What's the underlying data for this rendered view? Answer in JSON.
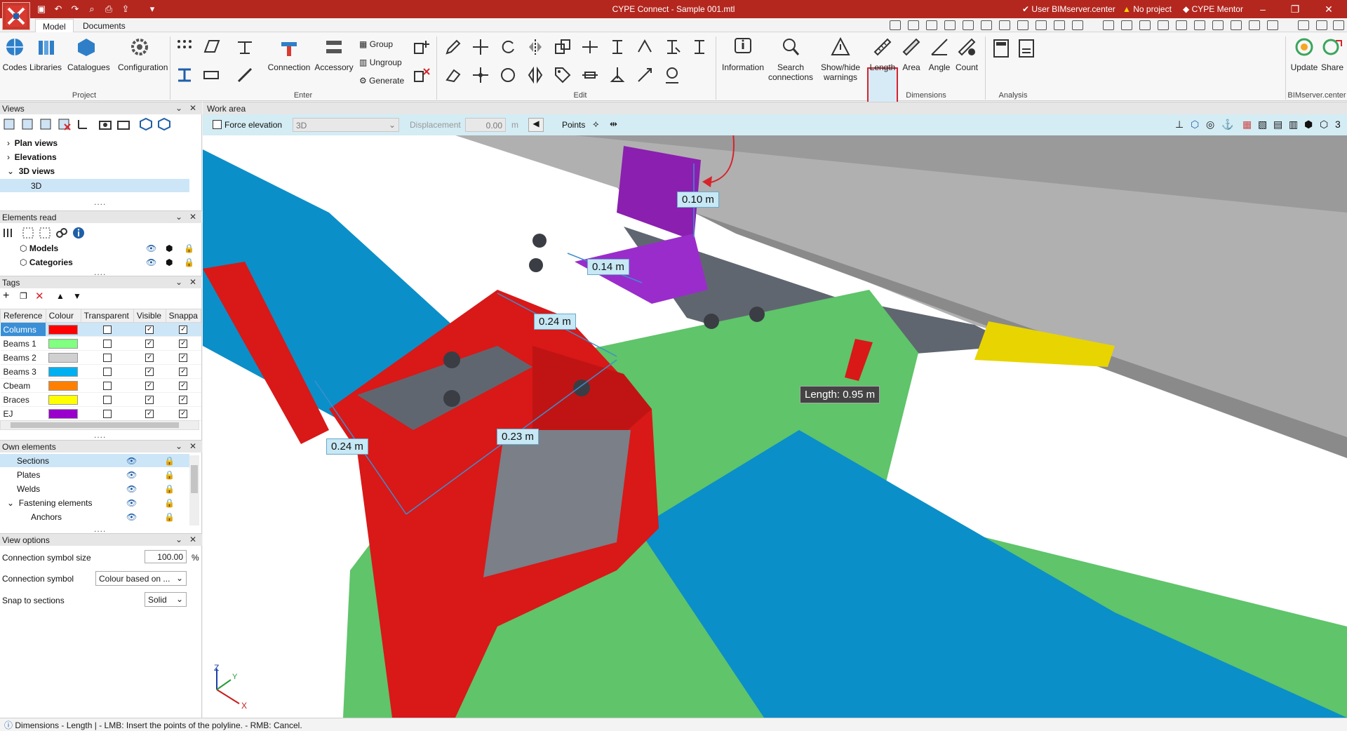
{
  "app": {
    "title": "CYPE Connect - Sample 001.mtl",
    "user": "User BIMserver.center",
    "project": "No project",
    "mentor": "CYPE Mentor"
  },
  "tabs": [
    "Model",
    "Documents"
  ],
  "ribbon": {
    "project": {
      "label": "Project",
      "buttons": [
        "Codes",
        "Libraries",
        "Catalogues",
        "Configuration"
      ]
    },
    "enter": {
      "label": "Enter",
      "buttons": [
        "Connection",
        "Accessory"
      ],
      "small": [
        "Group",
        "Ungroup",
        "Generate"
      ]
    },
    "edit": {
      "label": "Edit"
    },
    "info": {
      "buttons": [
        "Information",
        "Search connections",
        "Show/hide warnings"
      ]
    },
    "dimensions": {
      "label": "Dimensions",
      "buttons": [
        "Length",
        "Area",
        "Angle",
        "Count"
      ]
    },
    "analysis": {
      "label": "Analysis"
    },
    "bimserver": {
      "label": "BIMserver.center",
      "buttons": [
        "Update",
        "Share"
      ]
    }
  },
  "views_panel": {
    "title": "Views",
    "items": [
      "Plan views",
      "Elevations",
      "3D views"
    ],
    "selected_child": "3D"
  },
  "elements_read": {
    "title": "Elements read",
    "items": [
      "Models",
      "Categories"
    ]
  },
  "tags_panel": {
    "title": "Tags",
    "columns": [
      "Reference",
      "Colour",
      "Transparent",
      "Visible",
      "Snappa"
    ],
    "rows": [
      {
        "reference": "Columns",
        "colour": "#ff0000",
        "transparent": false,
        "visible": true,
        "snap": true
      },
      {
        "reference": "Beams 1",
        "colour": "#80ff80",
        "transparent": false,
        "visible": true,
        "snap": true
      },
      {
        "reference": "Beams 2",
        "colour": "#d0d0d0",
        "transparent": false,
        "visible": true,
        "snap": true
      },
      {
        "reference": "Beams 3",
        "colour": "#00b0f0",
        "transparent": false,
        "visible": true,
        "snap": true
      },
      {
        "reference": "Cbeam",
        "colour": "#ff8000",
        "transparent": false,
        "visible": true,
        "snap": true
      },
      {
        "reference": "Braces",
        "colour": "#ffff00",
        "transparent": false,
        "visible": true,
        "snap": true
      },
      {
        "reference": "EJ",
        "colour": "#9900cc",
        "transparent": false,
        "visible": true,
        "snap": true
      }
    ]
  },
  "own_elements": {
    "title": "Own elements",
    "items": [
      "Sections",
      "Plates",
      "Welds",
      "Fastening elements",
      "Anchors"
    ]
  },
  "view_options": {
    "title": "View options",
    "symbol_size_label": "Connection symbol size",
    "symbol_size_value": "100.00",
    "symbol_size_unit": "%",
    "symbol_label": "Connection symbol",
    "symbol_value": "Colour based on ...",
    "snap_label": "Snap to sections",
    "snap_value": "Solid"
  },
  "work_area": {
    "title": "Work area",
    "force_elevation": "Force elevation",
    "view_select": "3D",
    "displacement_label": "Displacement",
    "displacement_value": "0.00",
    "displacement_unit": "m",
    "points_label": "Points",
    "dimensions": {
      "d1": "0.10 m",
      "d2": "0.14 m",
      "d3": "0.24 m",
      "d4": "0.24 m",
      "d5": "0.23 m"
    },
    "length_tip": "Length: 0.95 m",
    "axes": {
      "z": "Z",
      "y": "Y",
      "x": "X"
    }
  },
  "status": {
    "text": "Dimensions - Length  |  - LMB: Insert the points of the polyline. - RMB: Cancel."
  },
  "colors": {
    "titlebar": "#b3271f",
    "highlight": "#d7232b",
    "toolbar_blue": "#d4ecf4"
  }
}
